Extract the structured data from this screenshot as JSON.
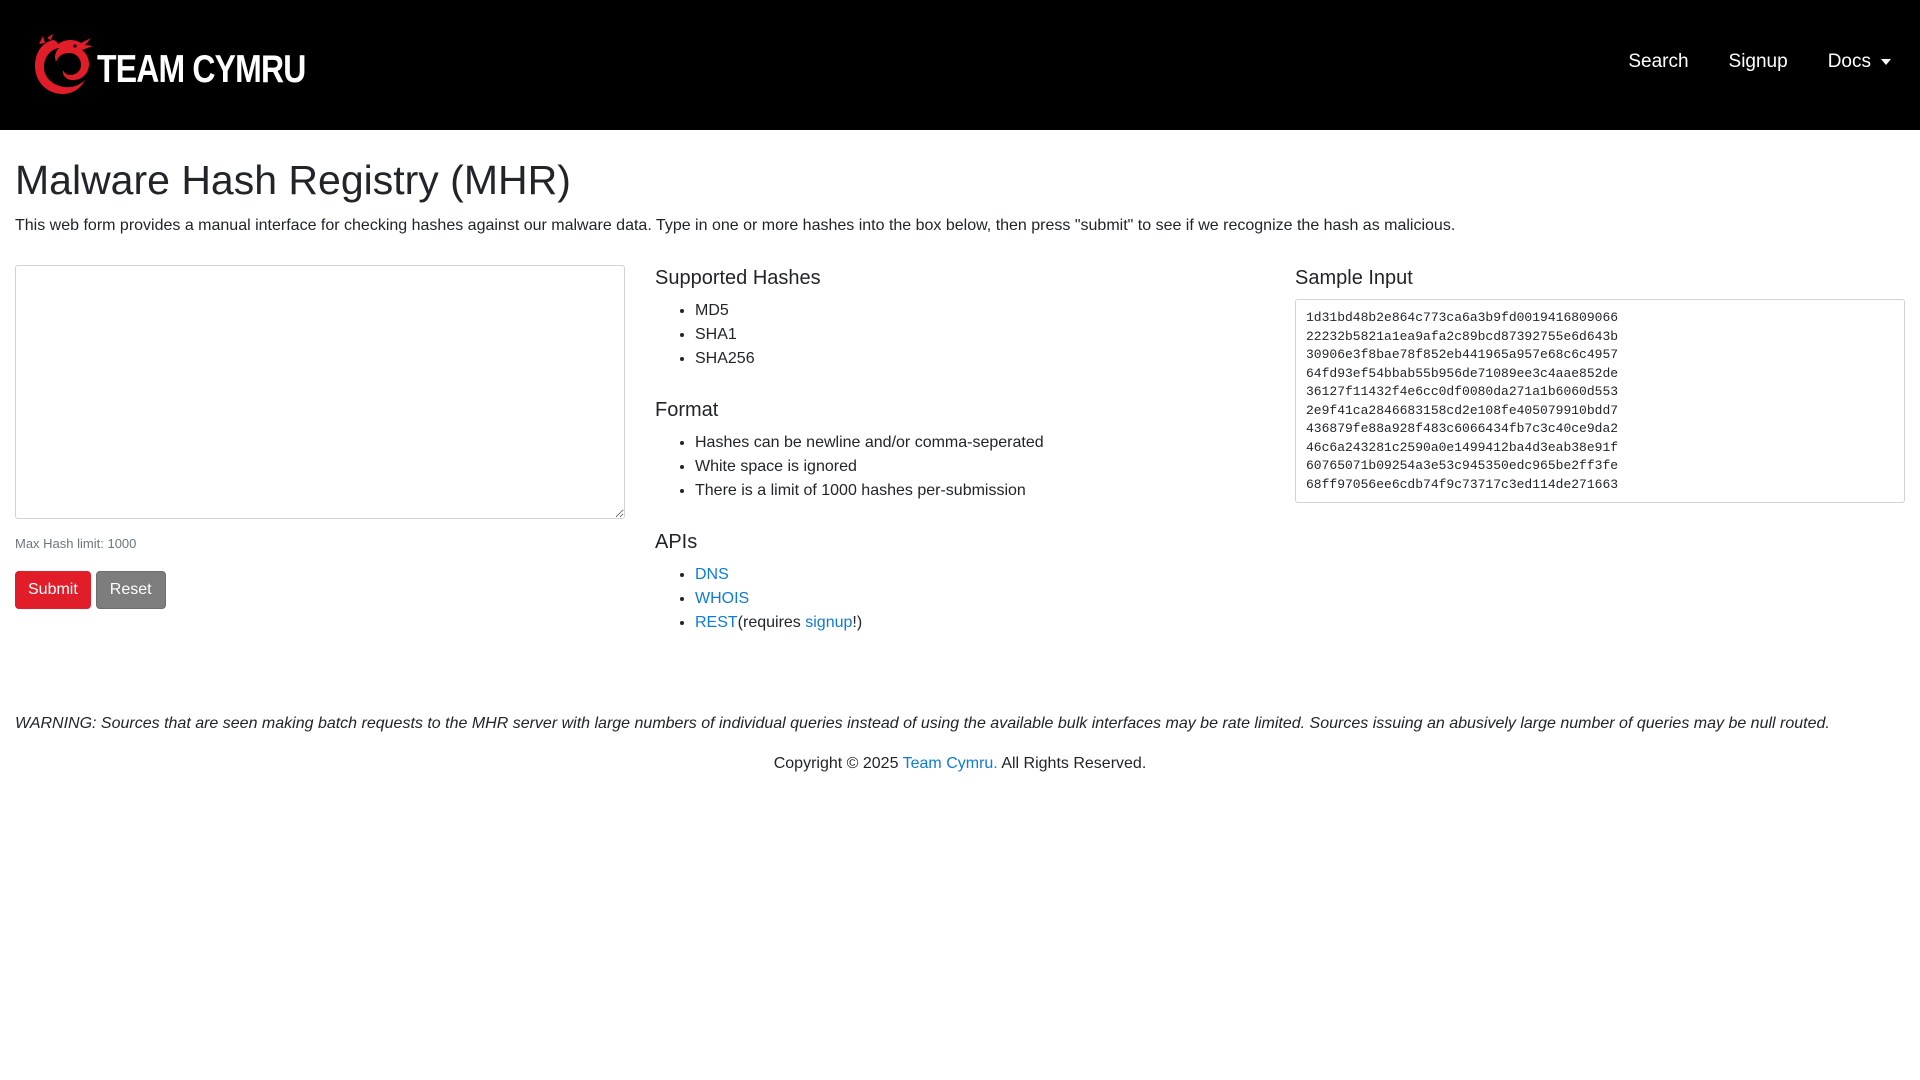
{
  "nav": {
    "brand": "TEAM CYMRU",
    "links": {
      "search": "Search",
      "signup": "Signup",
      "docs": "Docs"
    }
  },
  "page": {
    "title": "Malware Hash Registry (MHR)",
    "intro": "This web form provides a manual interface for checking hashes against our malware data. Type in one or more hashes into the box below, then press \"submit\" to see if we recognize the hash as malicious."
  },
  "form": {
    "textarea_value": "",
    "limit_text": "Max Hash limit: 1000",
    "submit_label": "Submit",
    "reset_label": "Reset"
  },
  "supported": {
    "title": "Supported Hashes",
    "items": [
      "MD5",
      "SHA1",
      "SHA256"
    ]
  },
  "format": {
    "title": "Format",
    "items": [
      "Hashes can be newline and/or comma-seperated",
      "White space is ignored",
      "There is a limit of 1000 hashes per-submission"
    ]
  },
  "apis": {
    "title": "APIs",
    "dns": "DNS",
    "whois": "WHOIS",
    "rest": "REST",
    "rest_suffix_open": "(requires ",
    "signup": "signup",
    "rest_suffix_close": "!)"
  },
  "sample": {
    "title": "Sample Input",
    "lines": [
      "1d31bd48b2e864c773ca6a3b9fd0019416809066",
      "22232b5821a1ea9afa2c89bcd87392755e6d643b",
      "30906e3f8bae78f852eb441965a957e68c6c4957",
      "64fd93ef54bbab55b956de71089ee3c4aae852de",
      "36127f11432f4e6cc0df0080da271a1b6060d553",
      "2e9f41ca2846683158cd2e108fe405079910bdd7",
      "436879fe88a928f483c6066434fb7c3c40ce9da2",
      "46c6a243281c2590a0e1499412ba4d3eab38e91f",
      "60765071b09254a3e53c945350edc965be2ff3fe",
      "68ff97056ee6cdb74f9c73717c3ed114de271663"
    ]
  },
  "warning": "WARNING: Sources that are seen making batch requests to the MHR server with large numbers of individual queries instead of using the available bulk interfaces may be rate limited. Sources issuing an abusively large number of queries may be null routed.",
  "footer": {
    "prefix": "Copyright © 2025 ",
    "link": "Team Cymru.",
    "suffix": " All Rights Reserved."
  },
  "colors": {
    "navbar_bg": "#000000",
    "brand_red": "#e11d2a",
    "link_blue": "#0d7bd8",
    "reset_gray": "#7d7d7d"
  },
  "icons": {
    "logo": "dragon-logo-icon",
    "docs_caret": "caret-down-icon"
  }
}
